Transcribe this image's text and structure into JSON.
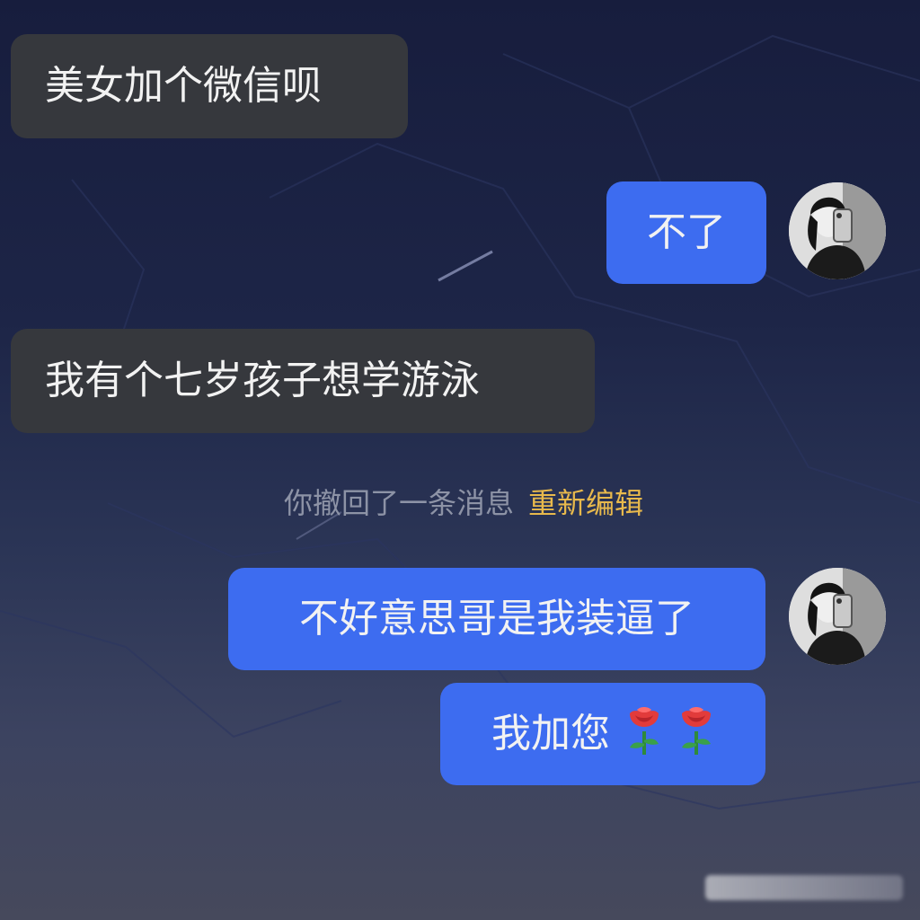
{
  "colors": {
    "incoming_bubble": "#36383d",
    "outgoing_bubble": "#3d6cf0",
    "system_text": "#8d93a6",
    "action_link": "#e8b94c",
    "background": "#1d2547"
  },
  "messages": [
    {
      "side": "incoming",
      "text": "美女加个微信呗"
    },
    {
      "side": "outgoing",
      "text": "不了"
    },
    {
      "side": "incoming",
      "text": "我有个七岁孩子想学游泳"
    },
    {
      "side": "outgoing",
      "text": "不好意思哥是我装逼了"
    },
    {
      "side": "outgoing",
      "text": "我加您",
      "icons": [
        "rose-icon",
        "rose-icon"
      ]
    }
  ],
  "system_notice": {
    "text": "你撤回了一条消息",
    "action_label": "重新编辑"
  }
}
